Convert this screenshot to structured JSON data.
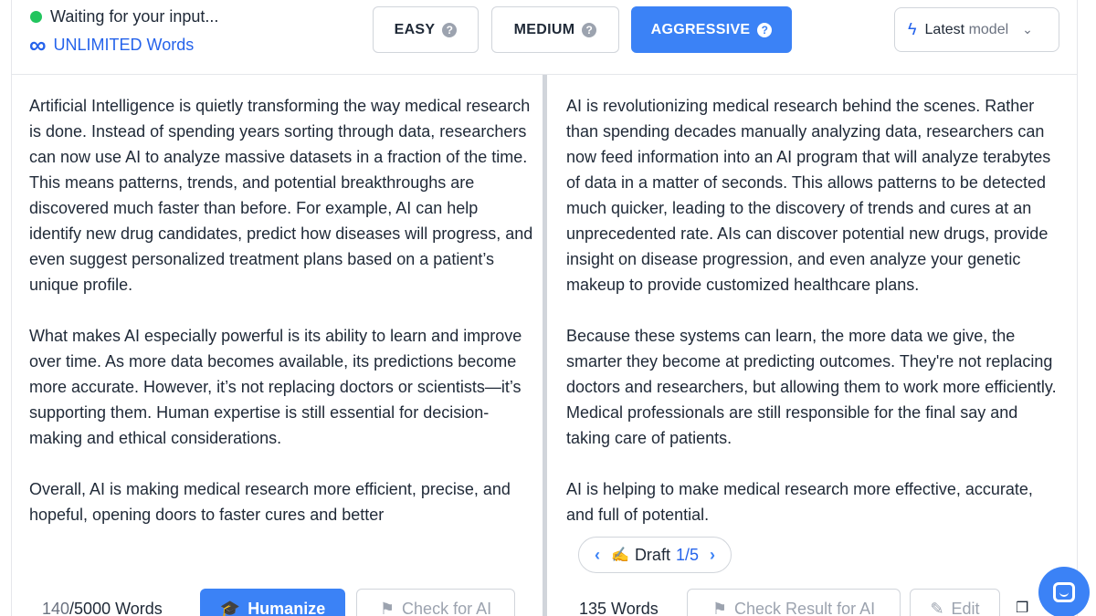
{
  "header": {
    "status_text": "Waiting for your input...",
    "limit_text": "UNLIMITED Words",
    "modes": [
      {
        "label": "EASY",
        "active": false
      },
      {
        "label": "MEDIUM",
        "active": false
      },
      {
        "label": "AGGRESSIVE",
        "active": true
      }
    ],
    "help_glyph": "?",
    "model_select": {
      "bold": "Latest",
      "muted": "model"
    }
  },
  "input_panel": {
    "text": "Artificial Intelligence is quietly transforming the way medical research is done. Instead of spending years sorting through data, researchers can now use AI to analyze massive datasets in a fraction of the time. This means patterns, trends, and potential breakthroughs are discovered much faster than before. For example, AI can help identify new drug candidates, predict how diseases will progress, and even suggest personalized treatment plans based on a patient’s unique profile.\n\nWhat makes AI especially powerful is its ability to learn and improve over time. As more data becomes available, its predictions become more accurate. However, it’s not replacing doctors or scientists—it’s supporting them. Human expertise is still essential for decision-making and ethical considerations.\n\nOverall, AI is making medical research more efficient, precise, and hopeful, opening doors to faster cures and better",
    "word_count": "140",
    "word_limit": "/5000 Words",
    "humanize_label": "Humanize",
    "check_label": "Check for AI"
  },
  "output_panel": {
    "text": "AI is revolutionizing medical research behind the scenes. Rather than spending decades manually analyzing data, researchers can now feed information into an AI program that will analyze terabytes of data in a matter of seconds. This allows patterns to be detected much quicker, leading to the discovery of trends and cures at an unprecedented rate. AIs can discover potential new drugs, provide insight on disease progression, and even analyze your genetic makeup to provide customized healthcare plans.\n\nBecause these systems can learn, the more data we give, the smarter they become at predicting outcomes. They're not replacing doctors and researchers, but allowing them to work more efficiently. Medical professionals are still responsible for the final say and taking care of patients.\n\nAI is helping to make medical research more effective, accurate, and full of potential.",
    "draft_label": "Draft",
    "draft_current": "1",
    "draft_total": "/5",
    "word_count": "135 Words",
    "check_result_label": "Check Result for AI",
    "edit_label": "Edit"
  },
  "colors": {
    "accent": "#3b82f6",
    "status": "#22c55e",
    "link": "#2563eb"
  },
  "icons": [
    "status-dot",
    "infinity-icon",
    "help-icon",
    "lightning-icon",
    "chevron-down-icon",
    "graduation-cap-icon",
    "flag-icon",
    "pencil-icon",
    "copy-icon",
    "chat-icon",
    "chevron-left-icon",
    "chevron-right-icon"
  ]
}
